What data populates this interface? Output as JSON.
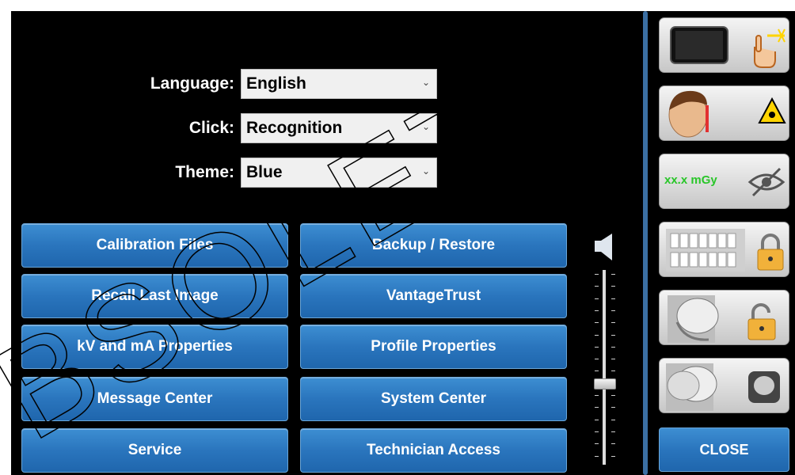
{
  "settings": {
    "language": {
      "label": "Language:",
      "value": "English"
    },
    "click": {
      "label": "Click:",
      "value": "Recognition"
    },
    "theme": {
      "label": "Theme:",
      "value": "Blue"
    }
  },
  "buttons": {
    "calibration_files": "Calibration Files",
    "backup_restore": "Backup / Restore",
    "recall_last_image": "Recall Last Image",
    "vantage_trust": "VantageTrust",
    "kv_ma_properties": "kV and mA Properties",
    "profile_properties": "Profile Properties",
    "message_center": "Message Center",
    "system_center": "System Center",
    "service": "Service",
    "technician_access": "Technician Access"
  },
  "toolbar": {
    "dose_text": "xx.x mGy",
    "close_label": "CLOSE"
  },
  "volume": {
    "level": 0.42
  },
  "watermark": "BSOLETE",
  "colors": {
    "background": "#000000",
    "button_blue": "#2a75bd",
    "divider": "#3b6fa3",
    "dose_green": "#29c629"
  },
  "icons": [
    "display-touch-icon",
    "patient-laser-icon",
    "dose-hidden-icon",
    "dentition-lock-icon",
    "ceph-unlock-icon",
    "ceph-view-icon",
    "volume-speaker-icon"
  ]
}
